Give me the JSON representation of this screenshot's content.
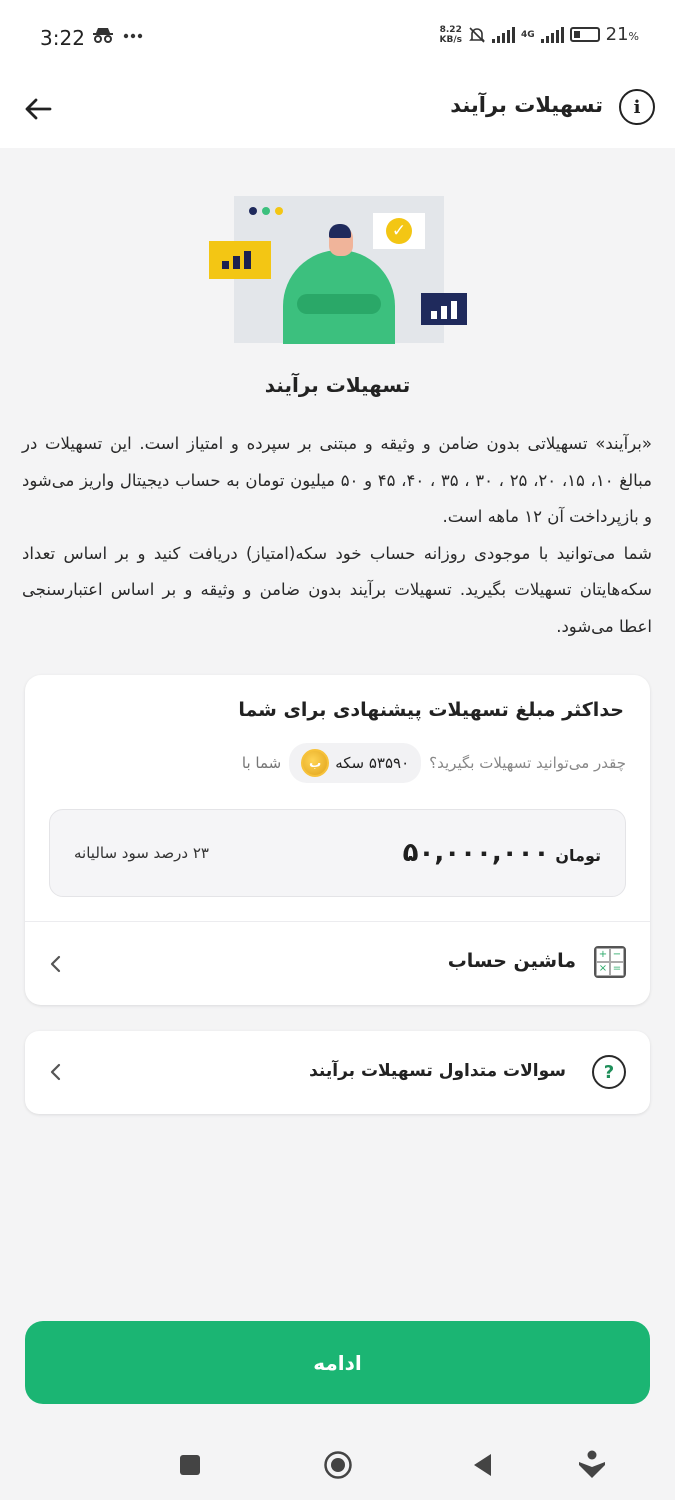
{
  "status_bar": {
    "time": "3:22",
    "left_icons": [
      "incognito-icon",
      "more-icon"
    ],
    "net_speed": "8.22",
    "net_speed_unit": "KB/s",
    "network": "4G",
    "battery": "21",
    "battery_unit": "%"
  },
  "header": {
    "title": "تسهیلات برآیند",
    "info_icon": "info-icon",
    "back_icon": "arrow-left-icon"
  },
  "hero": {
    "image": "illustration-person-charts",
    "colors": {
      "green": "#3cc07e",
      "yellow": "#f3c614",
      "navy": "#1f2a5c",
      "bg": "#e3e6ea"
    }
  },
  "intro": {
    "title": "تسهیلات برآیند",
    "paragraph1": "«برآیند» تسهیلاتی بدون ضامن و وثیقه و مبتنی بر سپرده و امتیاز است. این تسهیلات در مبالغ ۱۰، ۱۵، ۲۰، ۲۵ ، ۳۰ ، ۳۵ ، ۴۰، ۴۵ و ۵۰ میلیون تومان به حساب دیجیتال واریز می‌شود و بازپرداخت آن ۱۲ ماهه است.",
    "paragraph2": "شما می‌توانید با موجودی روزانه حساب خود سکه(امتیاز) دریافت کنید و بر اساس تعداد سکه‌هایتان تسهیلات بگیرید. تسهیلات برآیند بدون ضامن و وثیقه و بر اساس اعتبارسنجی اعطا می‌شود."
  },
  "offer": {
    "title": "حداکثر مبلغ تسهیلات پیشنهادی برای شما",
    "prefix": "شما با",
    "coin_count": "۵۳۵۹۰ سکه",
    "suffix": "چقدر می‌توانید تسهیلات بگیرید؟",
    "amount": "۵۰,۰۰۰,۰۰۰",
    "amount_unit": "تومان",
    "rate": "۲۳ درصد سود سالیانه",
    "calculator_label": "ماشین حساب",
    "calculator_icon": "calculator-icon",
    "coin_icon": "coin-icon"
  },
  "faq": {
    "label": "سوالات متداول تسهیلات برآیند",
    "icon": "question-circle-icon"
  },
  "continue_button": {
    "label": "ادامه",
    "color": "#1bb573"
  },
  "nav_bar": [
    "recent-apps-icon",
    "home-icon",
    "back-triangle-icon",
    "accessibility-icon"
  ]
}
